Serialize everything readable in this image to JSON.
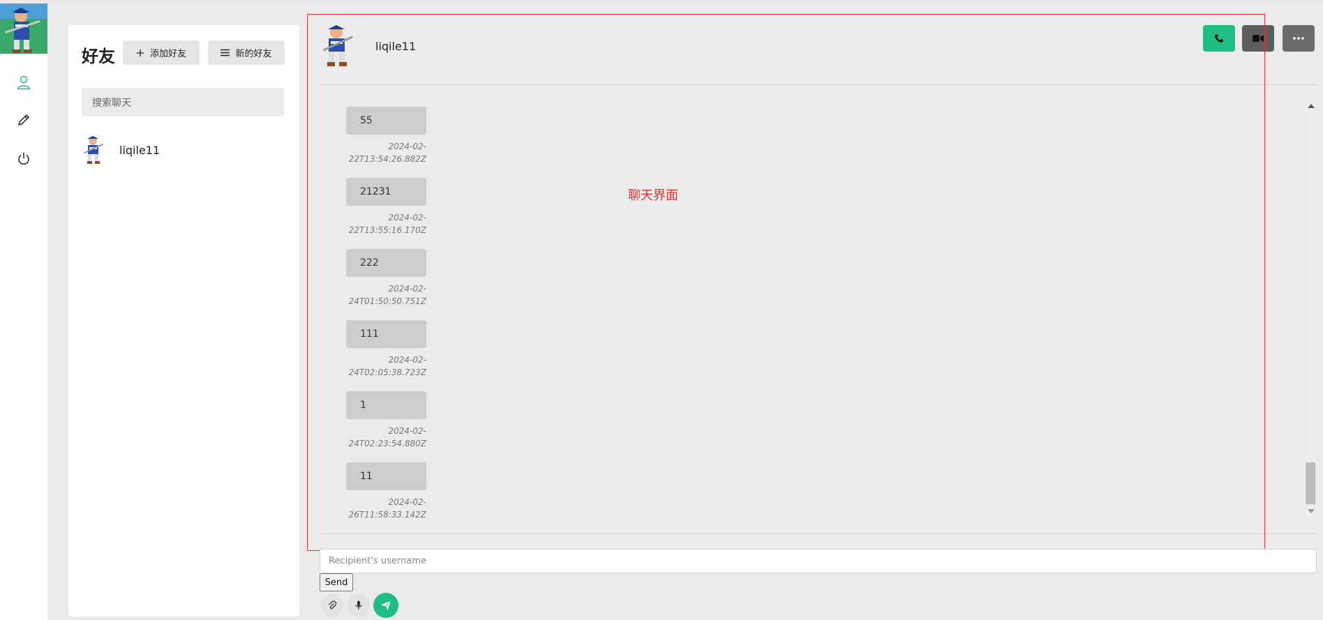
{
  "friends_panel": {
    "title": "好友",
    "add_friend_label": "添加好友",
    "new_friends_label": "新的好友",
    "search_placeholder": "搜索聊天",
    "friends": [
      {
        "name": "liqile11"
      }
    ]
  },
  "nav": {
    "icons": [
      "user-icon",
      "pencil-icon",
      "power-icon"
    ]
  },
  "chat": {
    "contact_name": "liqile11",
    "messages": [
      {
        "text": "55",
        "time_line1": "2024-02-",
        "time_line2": "22T13:54:26.882Z"
      },
      {
        "text": "21231",
        "time_line1": "2024-02-",
        "time_line2": "22T13:55:16.170Z"
      },
      {
        "text": "222",
        "time_line1": "2024-02-",
        "time_line2": "24T01:50:50.751Z"
      },
      {
        "text": "111",
        "time_line1": "2024-02-",
        "time_line2": "24T02:05:38.723Z"
      },
      {
        "text": "1",
        "time_line1": "2024-02-",
        "time_line2": "24T02:23:54.880Z"
      },
      {
        "text": "11",
        "time_line1": "2024-02-",
        "time_line2": "26T11:58:33.142Z"
      }
    ],
    "annotation_label": "聊天界面",
    "recipient_placeholder": "Recipient's username",
    "send_label": "Send"
  },
  "colors": {
    "accent_green": "#1fbc84",
    "annotation_red": "#e03030",
    "workspace_gray": "#ebebeb",
    "bubble_gray": "#cdcdcd"
  }
}
